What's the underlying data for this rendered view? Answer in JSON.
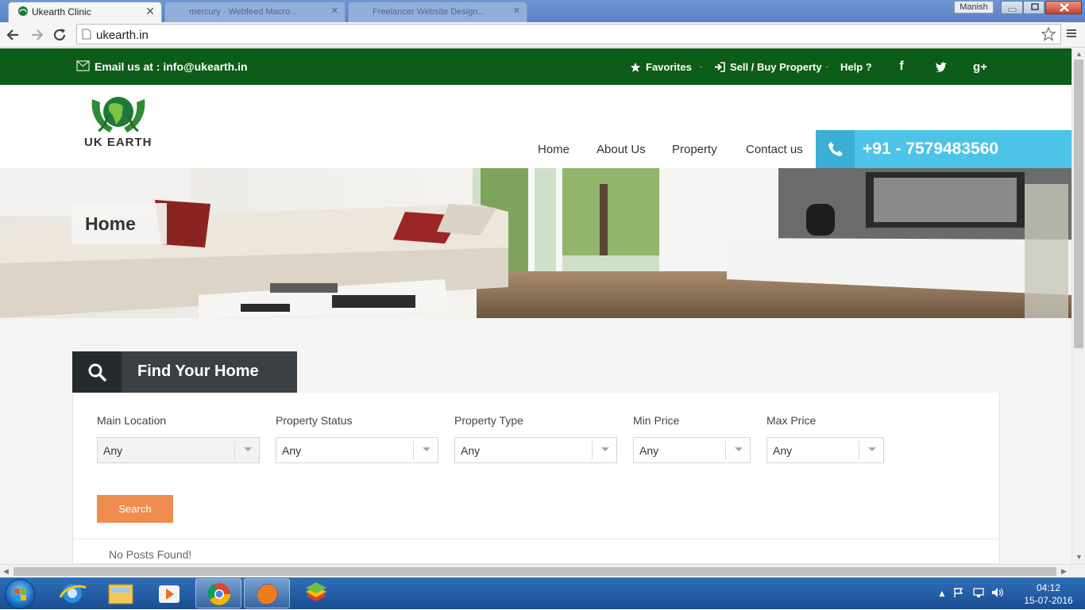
{
  "browser": {
    "tabs": [
      {
        "title": "Ukearth Clinic",
        "active": true
      },
      {
        "title": "mercury - Webfeed Macro...",
        "active": false
      },
      {
        "title": "Freelancer Website Design...",
        "active": false
      }
    ],
    "user": "Manish",
    "url": "ukearth.in"
  },
  "topbar": {
    "email_label": "Email us at : info@ukearth.in",
    "links": [
      "Favorites",
      "Sell / Buy Property",
      "Help ?"
    ],
    "separator": "-",
    "social": [
      "facebook-icon",
      "twitter-icon",
      "google-plus-icon"
    ]
  },
  "header": {
    "logo_text": "UK EARTH",
    "nav": [
      "Home",
      "About Us",
      "Property",
      "Contact us"
    ],
    "phone": "+91 - 7579483560"
  },
  "hero": {
    "title": "Home"
  },
  "search": {
    "heading": "Find Your Home",
    "fields": [
      {
        "label": "Main Location",
        "value": "Any"
      },
      {
        "label": "Property Status",
        "value": "Any"
      },
      {
        "label": "Property Type",
        "value": "Any"
      },
      {
        "label": "Min Price",
        "value": "Any"
      },
      {
        "label": "Max Price",
        "value": "Any"
      }
    ],
    "button": "Search",
    "no_results": "No Posts Found!"
  },
  "taskbar": {
    "time": "04:12",
    "date": "15-07-2016"
  },
  "colors": {
    "topbar": "#0d5c19",
    "phone_box": "#4ec3e8",
    "search_button": "#ef8c4f",
    "find_header": "#3a4044"
  }
}
